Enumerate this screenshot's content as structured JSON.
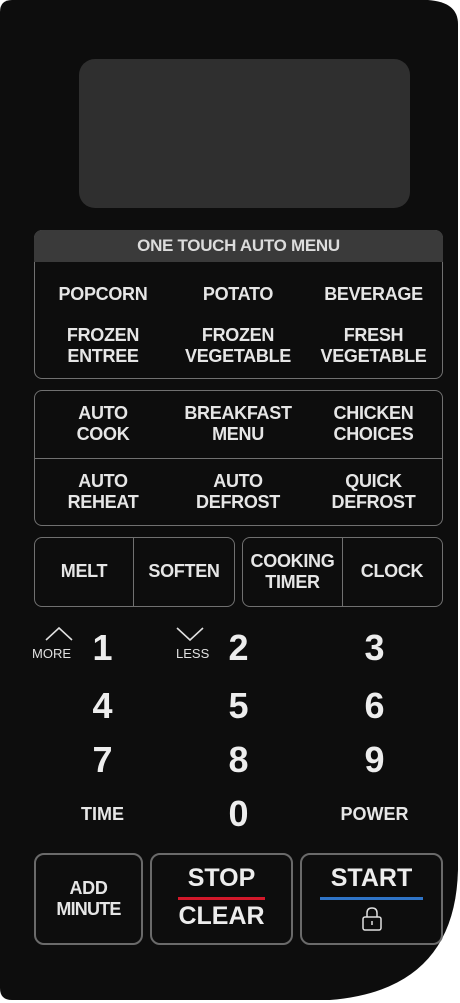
{
  "colors": {
    "panel": "#0d0d0d",
    "display": "#2f2f2f",
    "stop_accent": "#d3182a",
    "start_accent": "#2f74c7"
  },
  "auto_menu": {
    "title": "ONE TOUCH AUTO MENU",
    "row1": [
      "POPCORN",
      "POTATO",
      "BEVERAGE"
    ],
    "row2": [
      {
        "line1": "FROZEN",
        "line2": "ENTREE"
      },
      {
        "line1": "FROZEN",
        "line2": "VEGETABLE"
      },
      {
        "line1": "FRESH",
        "line2": "VEGETABLE"
      }
    ]
  },
  "cook_menu": {
    "row1": [
      {
        "line1": "AUTO",
        "line2": "COOK"
      },
      {
        "line1": "BREAKFAST",
        "line2": "MENU"
      },
      {
        "line1": "CHICKEN",
        "line2": "CHOICES"
      }
    ],
    "row2": [
      {
        "line1": "AUTO",
        "line2": "REHEAT"
      },
      {
        "line1": "AUTO",
        "line2": "DEFROST"
      },
      {
        "line1": "QUICK",
        "line2": "DEFROST"
      }
    ]
  },
  "function_keys": {
    "melt": "MELT",
    "soften": "SOFTEN",
    "cooking_timer": {
      "line1": "COOKING",
      "line2": "TIMER"
    },
    "clock": "CLOCK"
  },
  "keypad": {
    "digits": [
      "1",
      "2",
      "3",
      "4",
      "5",
      "6",
      "7",
      "8",
      "9",
      "0"
    ],
    "more": "MORE",
    "less": "LESS",
    "time": "TIME",
    "power": "POWER"
  },
  "bottom_buttons": {
    "add_minute": {
      "line1": "ADD",
      "line2": "MINUTE"
    },
    "stop": "STOP",
    "clear": "CLEAR",
    "start": "START",
    "lock_icon": "lock-icon"
  }
}
